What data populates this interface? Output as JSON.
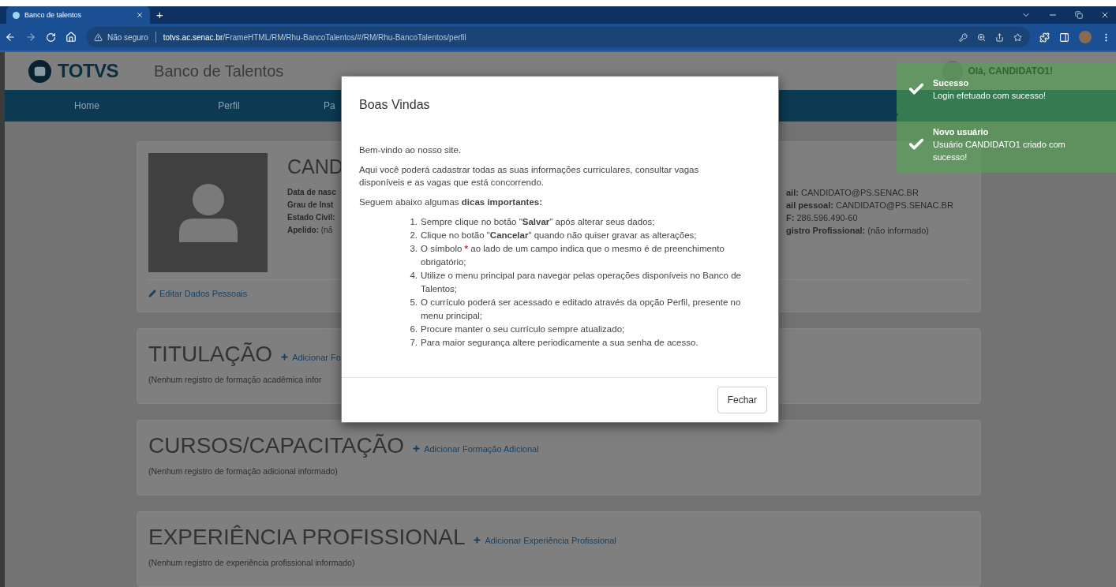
{
  "browser": {
    "tab": {
      "title": "Banco de talentos",
      "selected": true
    },
    "new_tab": "+",
    "security": "Não seguro",
    "url_host": "totvs.ac.senac.br",
    "url_path": "/FrameHTML/RM/Rhu-BancoTalentos/#/RM/Rhu-BancoTalentos/perfil"
  },
  "header": {
    "logo": "TOTVS",
    "title": "Banco de Talentos",
    "user": "Olá, CANDIDATO1!"
  },
  "nav": {
    "items": [
      {
        "label": "Home"
      },
      {
        "label": "Perfil"
      },
      {
        "label": "Pa"
      }
    ]
  },
  "profile": {
    "name": "CAND",
    "left_fields": [
      "**Data de nasc**",
      "**Grau de Inst**",
      "**Estado Civil:**",
      "**Apelido:** (nã"
    ],
    "right_fields": [
      "**ail:** CANDIDATO@PS.SENAC.BR",
      "**ail pessoal:** CANDIDATO@PS.SENAC.BR",
      "**F:** 286.596.490-60",
      "**gistro Profissional:** (não informado)"
    ],
    "edit_link": "Editar Dados Pessoais"
  },
  "sections": [
    {
      "title": "TITULAÇÃO",
      "add_link": "Adicionar Fo",
      "empty": "(Nenhum registro de formação acadêmica infor"
    },
    {
      "title": "CURSOS/CAPACITAÇÃO",
      "add_link": "Adicionar Formação Adicional",
      "empty": "(Nenhum registro de formação adicional informado)"
    },
    {
      "title": "EXPERIÊNCIA PROFISSIONAL",
      "add_link": "Adicionar Experiência Profissional",
      "empty": "(Nenhum registro de experiência profissional informado)"
    }
  ],
  "modal": {
    "title": "Boas Vindas",
    "paragraphs": [
      "Bem-vindo ao nosso site.",
      "Aqui você poderá cadastrar todas as suas informações curriculares, consultar vagas disponíveis e as vagas que está concorrendo.",
      "Seguem abaixo algumas **dicas importantes:**"
    ],
    "tips": [
      {
        "number": "1.",
        "parts": [
          {
            "kind": "text",
            "text": "Sempre clique no botão \"**Salvar**\" após alterar seus dados;"
          }
        ]
      },
      {
        "number": "2.",
        "parts": [
          {
            "kind": "text",
            "text": "Clique no botão \"**Cancelar**\" quando não quiser gravar as alterações;"
          }
        ]
      },
      {
        "number": "3.",
        "parts": [
          {
            "kind": "text",
            "text": "O símbolo "
          },
          {
            "kind": "required",
            "text": "*"
          },
          {
            "kind": "text",
            "text": " ao lado de um campo indica que o mesmo é de preenchimento obrigatório;"
          }
        ]
      },
      {
        "number": "4.",
        "parts": [
          {
            "kind": "text",
            "text": "Utilize o menu principal para navegar pelas operações disponíveis no Banco de Talentos;"
          }
        ]
      },
      {
        "number": "5.",
        "parts": [
          {
            "kind": "text",
            "text": "O currículo poderá ser acessado e editado através da opção Perfil, presente no menu principal;"
          }
        ]
      },
      {
        "number": "6.",
        "parts": [
          {
            "kind": "text",
            "text": "Procure manter o seu currículo sempre atualizado;"
          }
        ]
      },
      {
        "number": "7.",
        "parts": [
          {
            "kind": "text",
            "text": "Para maior segurança altere periodicamente a sua senha de acesso."
          }
        ]
      }
    ],
    "close_button": "Fechar"
  },
  "toasts": [
    {
      "kind": "success",
      "title": "Sucesso",
      "message": "Login efetuado com sucesso!"
    },
    {
      "kind": "success",
      "title": "Novo usuário",
      "message": "Usuário CANDIDATO1 criado com sucesso!"
    }
  ]
}
